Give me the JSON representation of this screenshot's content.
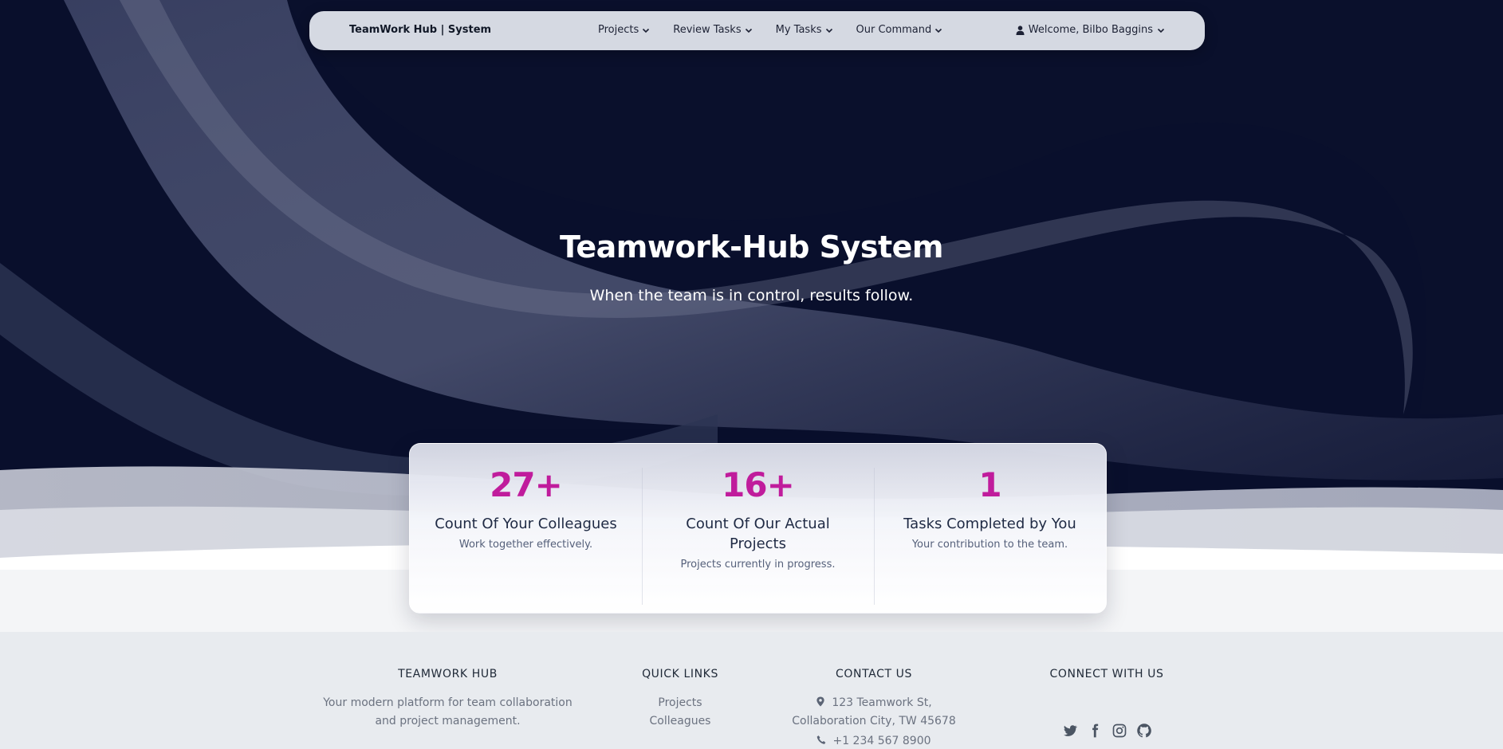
{
  "navbar": {
    "brand": "TeamWork Hub | System",
    "links": [
      {
        "label": "Projects",
        "icon": "chevron-down-icon"
      },
      {
        "label": "Review Tasks",
        "icon": "chevron-down-icon"
      },
      {
        "label": "My Tasks",
        "icon": "chevron-down-icon"
      },
      {
        "label": "Our Command",
        "icon": "chevron-down-icon"
      }
    ],
    "user": {
      "label": "Welcome, Bilbo Baggins",
      "icon": "user-icon"
    }
  },
  "hero": {
    "title": "Teamwork-Hub System",
    "subtitle": "When the team is in control, results follow."
  },
  "stats": [
    {
      "value": "27+",
      "title": "Count Of Your Colleagues",
      "desc": "Work together effectively."
    },
    {
      "value": "16+",
      "title": "Count Of Our Actual Projects",
      "desc": "Projects currently in progress."
    },
    {
      "value": "1",
      "title": "Tasks Completed by You",
      "desc": "Your contribution to the team."
    }
  ],
  "footer": {
    "about": {
      "heading": "TEAMWORK HUB",
      "text": "Your modern platform for team collaboration and project management."
    },
    "quick_links": {
      "heading": "QUICK LINKS",
      "items": [
        "Projects",
        "Colleagues"
      ]
    },
    "contact": {
      "heading": "CONTACT US",
      "address_line1": "123 Teamwork St,",
      "address_line2": "Collaboration City, TW 45678",
      "phone": "+1 234 567 8900"
    },
    "connect": {
      "heading": "CONNECT WITH US",
      "icons": [
        "twitter-icon",
        "facebook-icon",
        "instagram-icon",
        "github-icon"
      ]
    }
  },
  "colors": {
    "accent": "#c01c9c",
    "hero_bg": "#090f2c",
    "footer_bg": "#e8ebef"
  }
}
